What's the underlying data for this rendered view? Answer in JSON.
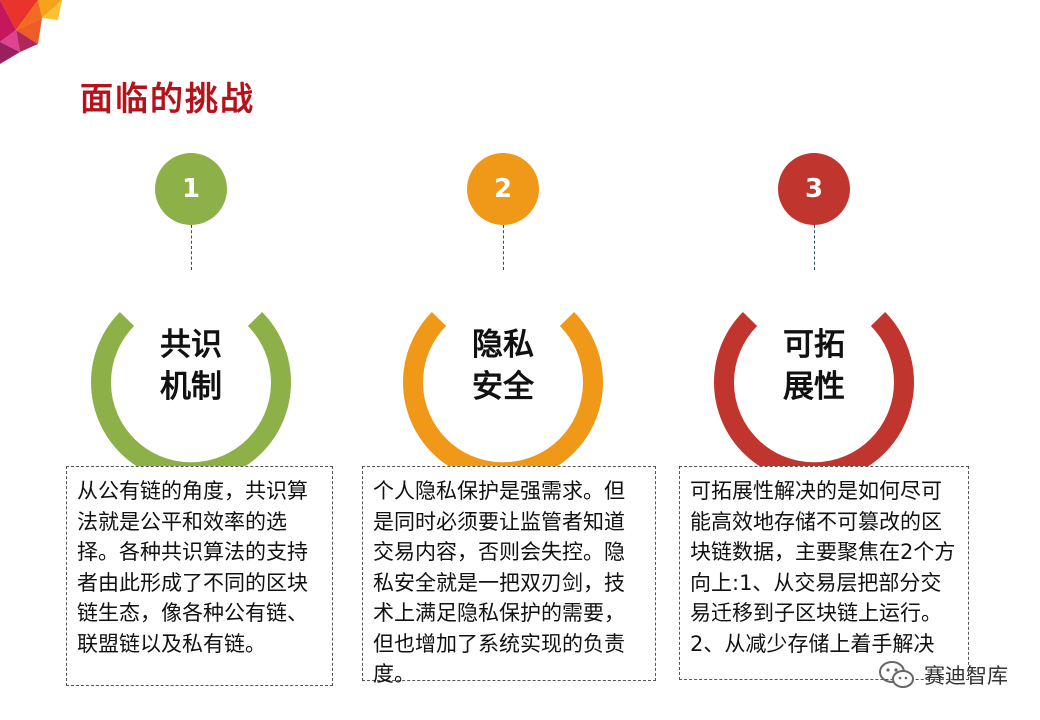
{
  "title": "面临的挑战",
  "colors": {
    "title": "#b5121b",
    "green": "#8db148",
    "orange": "#f09818",
    "red": "#c0352d"
  },
  "challenges": [
    {
      "number": "1",
      "label_line1": "共识",
      "label_line2": "机制",
      "description": "从公有链的角度，共识算法就是公平和效率的选择。各种共识算法的支持者由此形成了不同的区块链生态，像各种公有链、联盟链以及私有链。"
    },
    {
      "number": "2",
      "label_line1": "隐私",
      "label_line2": "安全",
      "description": "个人隐私保护是强需求。但是同时必须要让监管者知道交易内容，否则会失控。隐私安全就是一把双刃剑，技术上满足隐私保护的需要，但也增加了系统实现的负责度。"
    },
    {
      "number": "3",
      "label_line1": "可拓",
      "label_line2": "展性",
      "description": "可拓展性解决的是如何尽可能高效地存储不可篡改的区块链数据，主要聚焦在2个方向上:1、从交易层把部分交易迁移到子区块链上运行。2、从减少存储上着手解决"
    }
  ],
  "watermark": {
    "icon": "wechat-icon",
    "text": "赛迪智库"
  }
}
